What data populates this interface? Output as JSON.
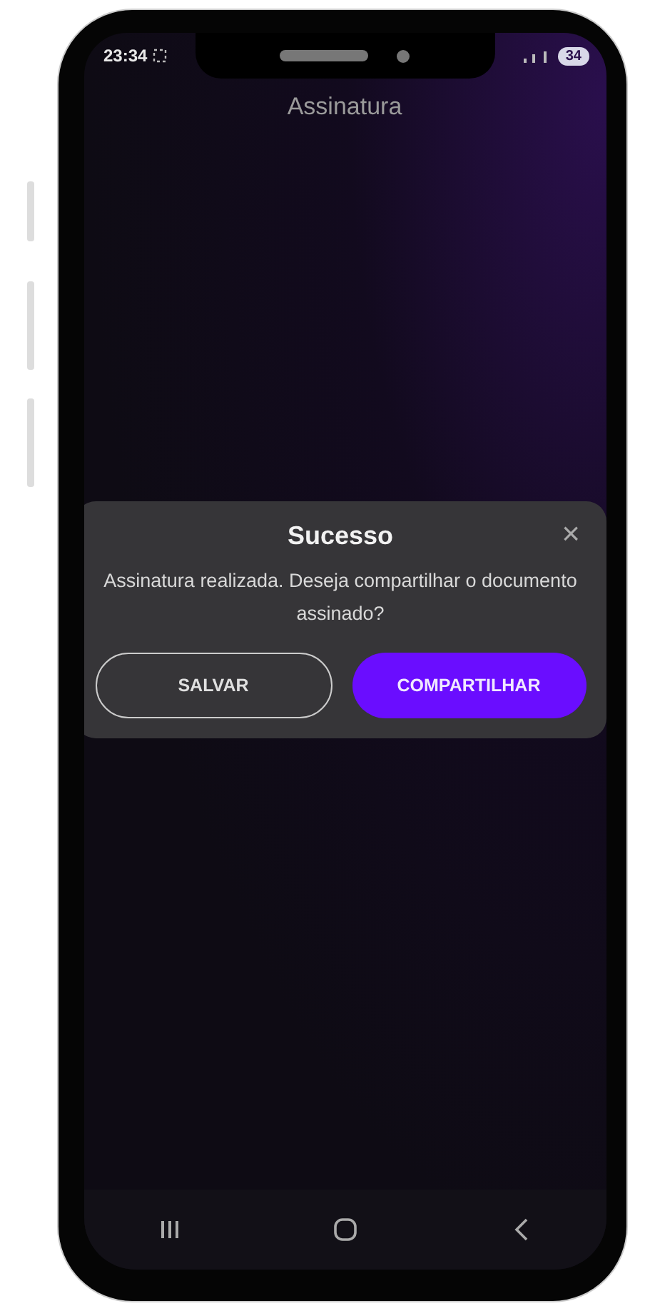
{
  "status_bar": {
    "time": "23:34",
    "battery": "34"
  },
  "header": {
    "title": "Assinatura"
  },
  "dialog": {
    "title": "Sucesso",
    "close": "×",
    "message": "Assinatura realizada. Deseja compartilhar o documento assinado?",
    "buttons": [
      {
        "label": "SALVAR",
        "kind": "outline"
      },
      {
        "label": "COMPARTILHAR",
        "kind": "primary"
      }
    ]
  }
}
